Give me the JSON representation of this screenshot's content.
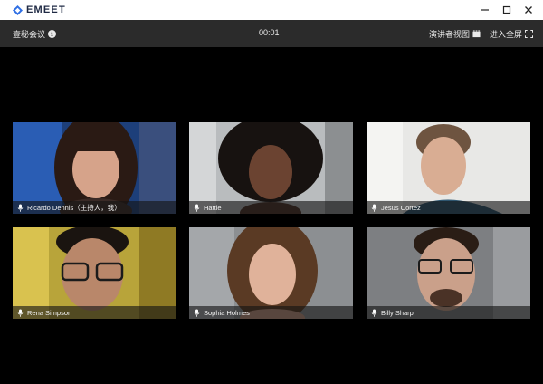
{
  "app": {
    "logo_text": "EMEET",
    "window_controls": [
      "minimize",
      "maximize",
      "close"
    ]
  },
  "toolbar": {
    "meeting_name": "壹秘会议",
    "timer": "00:01",
    "speaker_view_label": "演讲者视图",
    "fullscreen_label": "进入全屏"
  },
  "participants": [
    {
      "name": "Ricardo Dennis（主持人，我）",
      "muted": false
    },
    {
      "name": "Hattie",
      "muted": false
    },
    {
      "name": "Jesus Cortez",
      "muted": false
    },
    {
      "name": "Rena Simpson",
      "muted": false
    },
    {
      "name": "Sophia Holmes",
      "muted": false
    },
    {
      "name": "Billy Sharp",
      "muted": false
    }
  ],
  "colors": {
    "titlebar_bg": "#ffffff",
    "toolbar_bg": "#2b2b2b",
    "stage_bg": "#000000",
    "brand": "#1f2a44"
  }
}
